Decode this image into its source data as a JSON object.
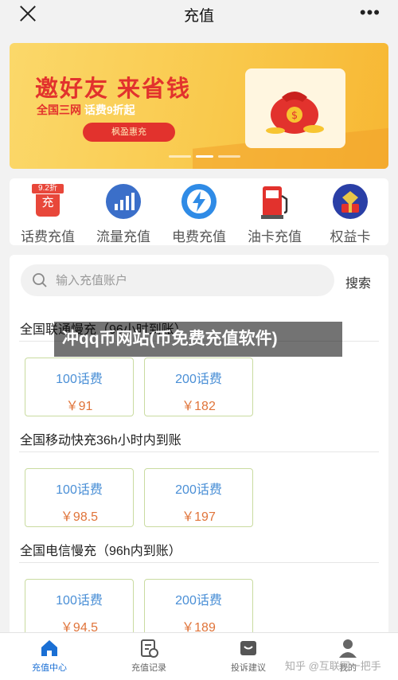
{
  "header": {
    "title": "充值",
    "close_icon": "close-icon",
    "more_label": "•••"
  },
  "banner": {
    "title": "邀好友  来省钱",
    "sub_prefix": "全国三网",
    "sub_text": "话费9折起",
    "button": "枫盈惠充"
  },
  "categories": [
    {
      "label": "话费充值",
      "badge": "9.2折",
      "glyph": "充",
      "icon": "phone-bill-icon"
    },
    {
      "label": "流量充值",
      "icon": "traffic-chart-icon"
    },
    {
      "label": "电费充值",
      "icon": "lightning-icon"
    },
    {
      "label": "油卡充值",
      "icon": "fuel-pump-icon"
    },
    {
      "label": "权益卡",
      "icon": "gift-box-icon"
    }
  ],
  "search": {
    "placeholder": "输入充值账户",
    "button": "搜索"
  },
  "sections": [
    {
      "title": "全国联通慢充（96小时到账）",
      "products": [
        {
          "name": "100话费",
          "price": "￥91"
        },
        {
          "name": "200话费",
          "price": "￥182"
        }
      ]
    },
    {
      "title": "全国移动快充36h小时内到账",
      "products": [
        {
          "name": "100话费",
          "price": "￥98.5"
        },
        {
          "name": "200话费",
          "price": "￥197"
        }
      ]
    },
    {
      "title": "全国电信慢充（96h内到账）",
      "products": [
        {
          "name": "100话费",
          "price": "￥94.5"
        },
        {
          "name": "200话费",
          "price": "￥189"
        }
      ]
    }
  ],
  "watermark": "冲qq币网站(币免费充值软件)",
  "nav": [
    {
      "label": "充值中心",
      "icon": "home-icon",
      "active": true
    },
    {
      "label": "充值记录",
      "icon": "records-icon"
    },
    {
      "label": "投诉建议",
      "icon": "feedback-icon"
    },
    {
      "label": "我的",
      "icon": "user-icon"
    }
  ],
  "credit": "知乎 @互联网一把手",
  "colors": {
    "accent": "#1a6fd4",
    "price": "#e0743a",
    "product_name": "#4a8fd6",
    "banner_red": "#e2322d"
  }
}
